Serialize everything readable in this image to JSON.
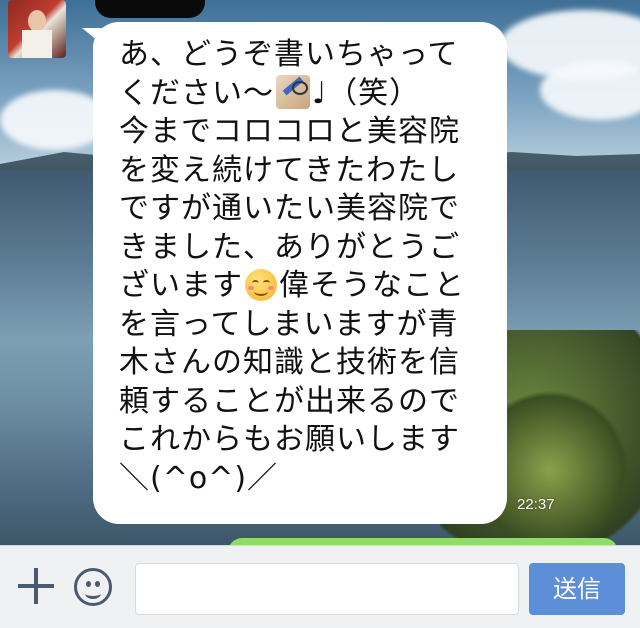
{
  "conversation": {
    "message": {
      "lines": [
        {
          "pre": "あ、どうぞ書いちゃって"
        },
        {
          "pre": "ください〜",
          "icon": "pencil-glasses-emoji",
          "post": "♩（笑）"
        },
        {
          "pre": "今までコロコロと美容院"
        },
        {
          "pre": "を変え続けてきたわたし"
        },
        {
          "pre": "ですが通いたい美容院で"
        },
        {
          "pre": "きました、ありがとうご"
        },
        {
          "pre": "ざいます",
          "icon": "smiling-face-emoji",
          "post": "偉そうなこと"
        },
        {
          "pre": "を言ってしまいますが青"
        },
        {
          "pre": "木さんの知識と技術を信"
        },
        {
          "pre": "頼することが出来るので"
        },
        {
          "pre": "これからもお願いします"
        },
        {
          "pre": "＼(^o^)／"
        }
      ],
      "time": "22:37"
    }
  },
  "composer": {
    "input_placeholder": "",
    "send_label": "送信",
    "plus_icon": "plus-icon",
    "sticker_icon": "smiley-icon"
  },
  "colors": {
    "bubble": "#ffffff",
    "send_button": "#5d8fd8",
    "outgoing_bubble": "#8edc6a"
  }
}
